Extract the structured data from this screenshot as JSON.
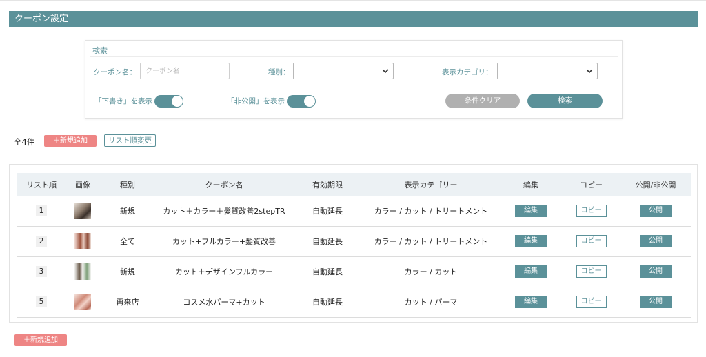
{
  "header": {
    "title": "クーポン設定"
  },
  "search": {
    "legend": "検索",
    "coupon_name_label": "クーポン名：",
    "coupon_name_placeholder": "クーポン名",
    "coupon_name_value": "",
    "type_label": "種別：",
    "type_value": "",
    "category_label": "表示カテゴリ：",
    "category_value": "",
    "show_draft_label": "「下書き」を表示",
    "show_draft_on": true,
    "show_private_label": "「非公開」を表示",
    "show_private_on": true,
    "clear_button": "条件クリア",
    "search_button": "検索"
  },
  "list": {
    "count": "全4件",
    "add_button": "＋新規追加",
    "reorder_button": "リスト順変更",
    "add_button_bottom": "＋新規追加"
  },
  "table": {
    "headers": {
      "order": "リスト順",
      "image": "画像",
      "type": "種別",
      "name": "クーポン名",
      "validity": "有効期限",
      "category": "表示カテゴリー",
      "edit": "編集",
      "copy": "コピー",
      "publish": "公開/非公開"
    },
    "rows": [
      {
        "order": "1",
        "type": "新規",
        "name": "カット＋カラー＋髪質改善2stepTR",
        "validity": "自動延長",
        "category": "カラー / カット / トリートメント",
        "edit": "編集",
        "copy": "コピー",
        "publish": "公開"
      },
      {
        "order": "2",
        "type": "全て",
        "name": "カット+フルカラー+髪質改善",
        "validity": "自動延長",
        "category": "カラー / カット / トリートメント",
        "edit": "編集",
        "copy": "コピー",
        "publish": "公開"
      },
      {
        "order": "3",
        "type": "新規",
        "name": "カット＋デザインフルカラー",
        "validity": "自動延長",
        "category": "カラー / カット",
        "edit": "編集",
        "copy": "コピー",
        "publish": "公開"
      },
      {
        "order": "5",
        "type": "再来店",
        "name": "コスメ水パーマ+カット",
        "validity": "自動延長",
        "category": "カット / パーマ",
        "edit": "編集",
        "copy": "コピー",
        "publish": "公開"
      }
    ]
  },
  "colors": {
    "accent": "#5b9199",
    "add_button": "#ee8584",
    "clear_button": "#b0b0b0",
    "table_header_bg": "#ecf1f4"
  },
  "icons": {
    "select_arrow": "chevron-down-icon",
    "row_image": "image-thumbnail"
  }
}
